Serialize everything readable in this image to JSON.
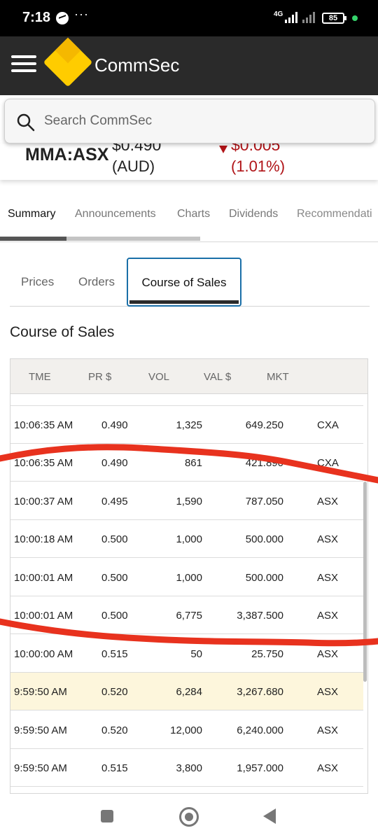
{
  "status_bar": {
    "time": "7:18",
    "more": "···",
    "network": "4G",
    "battery": "85"
  },
  "header": {
    "brand": "CommSec"
  },
  "search": {
    "placeholder": "Search CommSec"
  },
  "quote": {
    "code": "MMA:ASX",
    "price": "$0.490",
    "currency": "(AUD)",
    "change": "$0.005",
    "change_pct": "(1.01%)",
    "change_color": "#b01418"
  },
  "main_tabs": [
    {
      "label": "Summary",
      "active": true
    },
    {
      "label": "Announcements",
      "active": false
    },
    {
      "label": "Charts",
      "active": false
    },
    {
      "label": "Dividends",
      "active": false
    },
    {
      "label": "Recommendati",
      "active": false
    }
  ],
  "sub_tabs": [
    {
      "label": "Prices"
    },
    {
      "label": "Orders"
    },
    {
      "label": "Course of Sales",
      "active": true
    }
  ],
  "section_title": "Course of Sales",
  "table": {
    "headers": [
      "TME",
      "PR $",
      "VOL",
      "VAL $",
      "MKT"
    ],
    "rows": [
      {
        "time": "10:06:35 AM",
        "price": "0.490",
        "vol": "1,325",
        "val": "649.250",
        "mkt": "CXA"
      },
      {
        "time": "10:06:35 AM",
        "price": "0.490",
        "vol": "861",
        "val": "421.890",
        "mkt": "CXA"
      },
      {
        "time": "10:00:37 AM",
        "price": "0.495",
        "vol": "1,590",
        "val": "787.050",
        "mkt": "ASX"
      },
      {
        "time": "10:00:18 AM",
        "price": "0.500",
        "vol": "1,000",
        "val": "500.000",
        "mkt": "ASX"
      },
      {
        "time": "10:00:01 AM",
        "price": "0.500",
        "vol": "1,000",
        "val": "500.000",
        "mkt": "ASX"
      },
      {
        "time": "10:00:01 AM",
        "price": "0.500",
        "vol": "6,775",
        "val": "3,387.500",
        "mkt": "ASX"
      },
      {
        "time": "10:00:00 AM",
        "price": "0.515",
        "vol": "50",
        "val": "25.750",
        "mkt": "ASX"
      },
      {
        "time": "9:59:50 AM",
        "price": "0.520",
        "vol": "6,284",
        "val": "3,267.680",
        "mkt": "ASX",
        "highlight": true
      },
      {
        "time": "9:59:50 AM",
        "price": "0.520",
        "vol": "12,000",
        "val": "6,240.000",
        "mkt": "ASX"
      },
      {
        "time": "9:59:50 AM",
        "price": "0.515",
        "vol": "3,800",
        "val": "1,957.000",
        "mkt": "ASX"
      }
    ]
  },
  "colors": {
    "annotation": "#e8321e",
    "highlight_row": "#fdf6dc",
    "tab_border": "#1a6fa8"
  }
}
